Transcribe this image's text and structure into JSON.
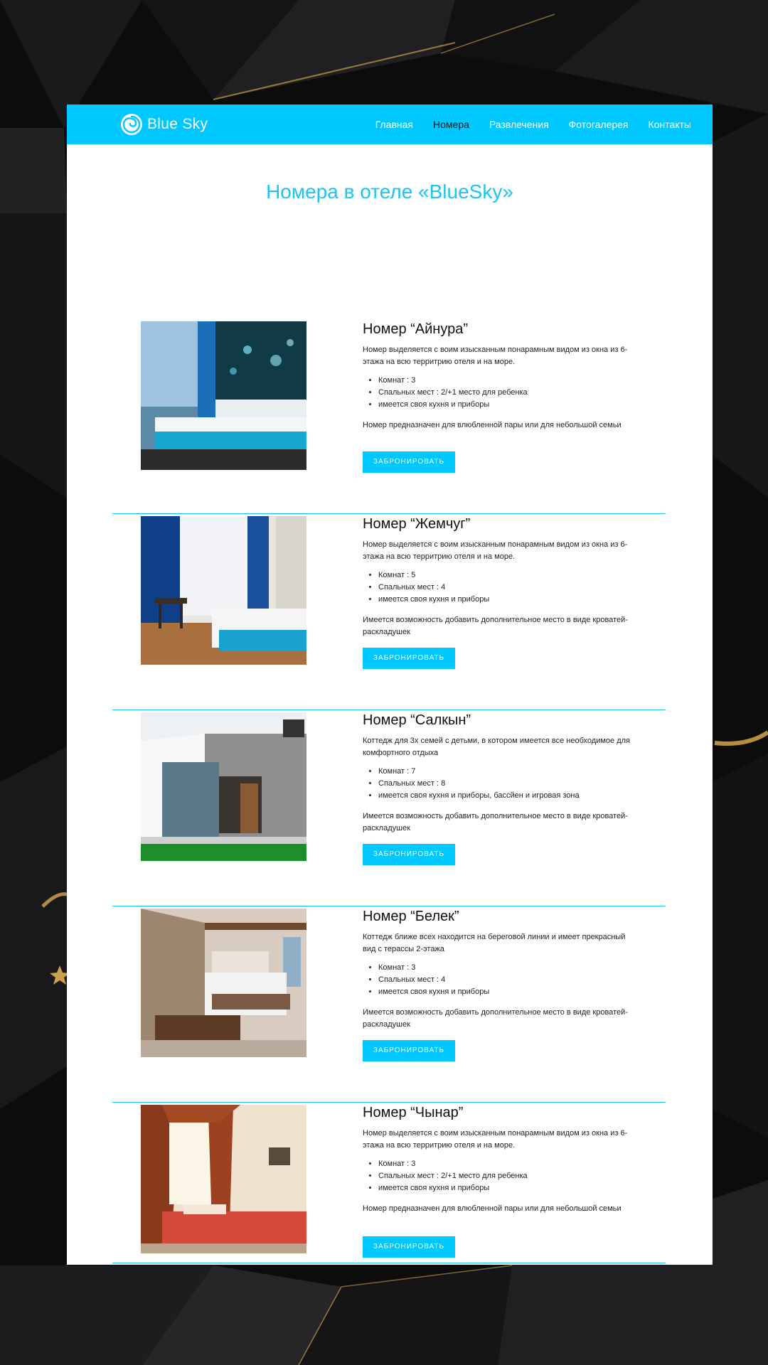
{
  "brand": {
    "name": "Blue Sky",
    "accent_color": "#00c8ff"
  },
  "nav": {
    "items": [
      {
        "label": "Главная",
        "active": false
      },
      {
        "label": "Номера",
        "active": true
      },
      {
        "label": "Развлечения",
        "active": false
      },
      {
        "label": "Фотогалерея",
        "active": false
      },
      {
        "label": "Контакты",
        "active": false
      }
    ]
  },
  "page_title": "Номера в отеле «BlueSky»",
  "book_label": "ЗАБРОНИРОВАТЬ",
  "rooms": [
    {
      "name": "Номер “Айнура”",
      "description": "Номер выделяется с воим изысканным понарамным видом из окна из 6-этажа на всю территрию отеля и на море.",
      "features": [
        "Комнат : 3",
        "Спальных мест : 2/+1 место для ребенка",
        "имеется своя кухня и приборы"
      ],
      "note": "Номер предназначен для влюбленной пары или для небольшой семьи",
      "photo": "hotel-room-sea-view-photo"
    },
    {
      "name": "Номер “Жемчуг”",
      "description": "Номер выделяется с воим изысканным понарамным видом из окна из 6-этажа на всю территрию отеля и на море.",
      "features": [
        "Комнат : 5",
        "Спальных мест : 4",
        "имеется своя кухня и приборы"
      ],
      "note": "Имеется возможность добавить дополнительное место в виде кроватей-раскладушек",
      "photo": "twin-room-blue-curtains-photo"
    },
    {
      "name": "Номер “Салкын”",
      "description": "Коттедж для 3х семей с детьми, в котором имеется все необходимое для комфортного отдыха",
      "features": [
        "Комнат : 7",
        "Спальных мест : 8",
        "имеется своя кухня и приборы, бассйен и игровая зона"
      ],
      "note": "Имеется возможность добавить дополнительное место в виде кроватей-раскладушек",
      "photo": "modern-cottage-photo"
    },
    {
      "name": "Номер “Белек”",
      "description": "Коттедж ближе всех находится на береговой линии и имеет прекрасный вид с терассы 2-этажа",
      "features": [
        "Комнат : 3",
        "Спальных мест : 4",
        "имеется своя кухня и приборы"
      ],
      "note": "Имеется возможность добавить дополнительное место в виде кроватей-раскладушек",
      "photo": "stone-wall-bedroom-photo"
    },
    {
      "name": "Номер “Чынар”",
      "description": "Номер выделяется с воим изысканным понарамным видом из окна из 6-этажа на всю территрию отеля и на море.",
      "features": [
        "Комнат : 3",
        "Спальных мест : 2/+1 место для ребенка",
        "имеется своя кухня и приборы"
      ],
      "note": "Номер предназначен для влюбленной пары или для небольшой семьи",
      "photo": "red-curtain-bedroom-photo"
    }
  ]
}
